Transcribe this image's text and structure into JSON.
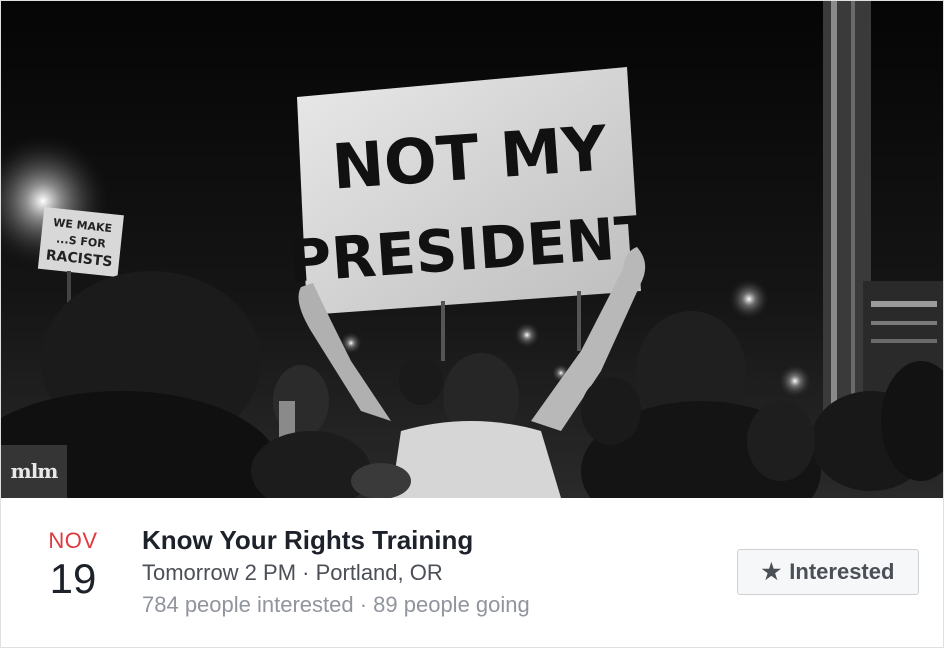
{
  "cover": {
    "sign_main_line1": "NOT MY",
    "sign_main_line2": "PRESIDENT",
    "sign_small_line1": "WE MAKE",
    "sign_small_line2": "...S FOR",
    "sign_small_line3": "RACISTS",
    "watermark": "mlm"
  },
  "event": {
    "month": "NOV",
    "day": "19",
    "title": "Know Your Rights Training",
    "when_where": "Tomorrow 2 PM · Portland, OR",
    "stats": "784 people interested · 89 people going"
  },
  "actions": {
    "interested_label": "Interested",
    "interested_icon": "star-icon"
  },
  "colors": {
    "month_red": "#e0393e",
    "title_text": "#1d2129",
    "secondary_text": "#4b4f56",
    "muted_text": "#90949c",
    "button_bg": "#f6f7f9",
    "button_border": "#ced0d4"
  }
}
